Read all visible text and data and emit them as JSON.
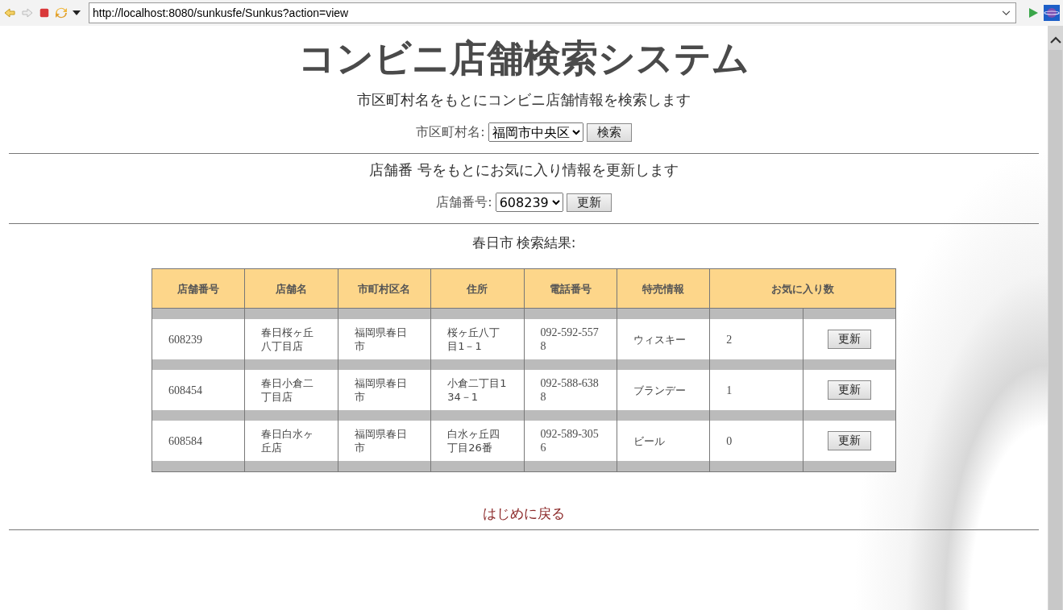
{
  "browser": {
    "url": "http://localhost:8080/sunkusfe/Sunkus?action=view"
  },
  "title": "コンビニ店舗検索システム",
  "search_section": {
    "description": "市区町村名をもとにコンビニ店舗情報を検索します",
    "label": "市区町村名:",
    "select_value": "福岡市中央区",
    "button": "検索"
  },
  "favorite_section": {
    "description": "店舗番 号をもとにお気に入り情報を更新します",
    "label": "店舗番号:",
    "select_value": "608239",
    "button": "更新"
  },
  "results": {
    "heading_city": "春日市",
    "heading_suffix": "検索結果:",
    "columns": [
      "店舗番号",
      "店舗名",
      "市町村区名",
      "住所",
      "電話番号",
      "特売情報",
      "お気に入り数"
    ],
    "rows": [
      {
        "store_no": "608239",
        "name": "春日桜ヶ丘八丁目店",
        "city": "福岡県春日市",
        "address": "桜ヶ丘八丁目1－1",
        "phone": "092-592-5578",
        "sale": "ウィスキー",
        "favorites": "2",
        "button": "更新"
      },
      {
        "store_no": "608454",
        "name": "春日小倉二丁目店",
        "city": "福岡県春日市",
        "address": "小倉二丁目134－1",
        "phone": "092-588-6388",
        "sale": "ブランデー",
        "favorites": "1",
        "button": "更新"
      },
      {
        "store_no": "608584",
        "name": "春日白水ヶ丘店",
        "city": "福岡県春日市",
        "address": "白水ヶ丘四丁目26番",
        "phone": "092-589-3056",
        "sale": "ビール",
        "favorites": "0",
        "button": "更新"
      }
    ]
  },
  "back_link": "はじめに戻る"
}
